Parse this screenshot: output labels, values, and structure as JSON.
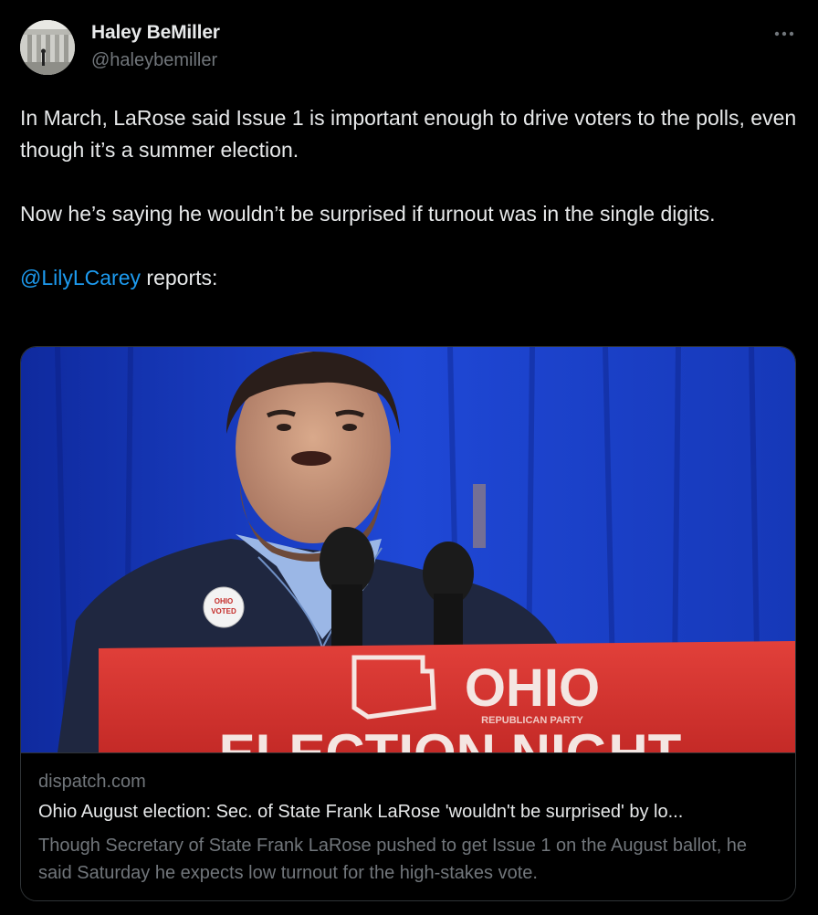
{
  "author": {
    "name": "Haley BeMiller",
    "handle": "@haleybemiller",
    "avatar_icon": "avatar-photo"
  },
  "more_icon": "more-horizontal-icon",
  "tweet": {
    "paragraph_1": "In March, LaRose said Issue 1 is important enough to drive voters to the polls, even though it’s a summer election.",
    "paragraph_2": "Now he’s saying he wouldn’t be surprised if turnout was in the single digits.",
    "mention": "@LilyLCarey",
    "paragraph_3_suffix": " reports:"
  },
  "card": {
    "domain": "dispatch.com",
    "title": "Ohio August election: Sec. of State Frank LaRose 'wouldn't be surprised' by lo...",
    "description": "Though Secretary of State Frank LaRose pushed to get Issue 1 on the August ballot, he said Saturday he expects low turnout for the high-stakes vote.",
    "image": {
      "podium_text": "OHIO",
      "podium_subtext": "REPUBLICAN PARTY",
      "podium_bottom_text": "ELECTION NIGHT",
      "button_text_top": "OHIO",
      "button_text_bottom": "VOTED"
    }
  },
  "colors": {
    "background": "#000000",
    "text_primary": "#e7e9ea",
    "text_secondary": "#71767b",
    "link": "#1d9bf0",
    "border": "#2f3336",
    "curtain_blue": "#1a3fc4",
    "podium_red": "#d8332f"
  }
}
